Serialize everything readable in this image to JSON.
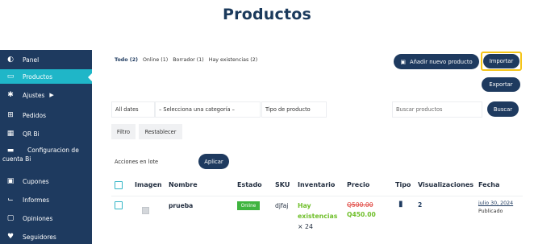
{
  "page": {
    "title": "Productos"
  },
  "sidebar": {
    "items": [
      {
        "label": "Panel",
        "icon": "dashboard-icon",
        "glyph": "◐",
        "active": false
      },
      {
        "label": "Productos",
        "icon": "products-icon",
        "glyph": "▭",
        "active": true
      },
      {
        "label": "Ajustes",
        "icon": "gear-icon",
        "glyph": "✱",
        "active": false,
        "arrow": "▶"
      },
      {
        "label": "Pedidos",
        "icon": "cart-icon",
        "glyph": "⊞",
        "active": false
      },
      {
        "label": "QR Bi",
        "icon": "qr-icon",
        "glyph": "▦",
        "active": false
      },
      {
        "label": "Configuracion de",
        "label2": "cuenta Bi",
        "icon": "card-icon",
        "glyph": "▬",
        "active": false
      },
      {
        "label": "Cupones",
        "icon": "gift-icon",
        "glyph": "▣",
        "active": false
      },
      {
        "label": "Informes",
        "icon": "chart-icon",
        "glyph": "⌙",
        "active": false
      },
      {
        "label": "Opiniones",
        "icon": "comments-icon",
        "glyph": "▢",
        "active": false
      },
      {
        "label": "Seguidores",
        "icon": "heart-icon",
        "glyph": "♥",
        "active": false
      }
    ]
  },
  "views": {
    "all": "Todo (2)",
    "online": "Online (1)",
    "draft": "Borrador (1)",
    "in_stock": "Hay existencias (2)"
  },
  "toolbar": {
    "add_label": "Añadir nuevo producto",
    "import_label": "Importar",
    "export_label": "Exportar"
  },
  "filters": {
    "dates": "All dates",
    "category": "– Selecciona una categoría –",
    "product_type": "Tipo de producto",
    "search_placeholder": "Buscar productos",
    "search_button": "Buscar",
    "filter_button": "Filtro",
    "reset_button": "Restablecer"
  },
  "bulk": {
    "label": "Acciones en lote",
    "apply": "Aplicar"
  },
  "table": {
    "headers": {
      "image": "Imagen",
      "name": "Nombre",
      "status": "Estado",
      "sku": "SKU",
      "inventory": "Inventario",
      "price": "Precio",
      "type": "Tipo",
      "views": "Visualizaciones",
      "date": "Fecha"
    },
    "rows": [
      {
        "name": "prueba",
        "status": "Online",
        "sku": "djfaj",
        "inventory_line1": "Hay",
        "inventory_line2": "existencias",
        "inventory_qty": "× 24",
        "price_old": "Q500.00",
        "price_new": "Q450.00",
        "type_icon": "simple-product-icon",
        "views": "2",
        "date": "julio 30, 2024",
        "date_status": "Publicado"
      }
    ]
  },
  "colors": {
    "navy": "#1e3a5f",
    "accent": "#1fb6c8",
    "highlight": "#f5c518",
    "success": "#6fbf2a",
    "sale": "#e0443e"
  }
}
